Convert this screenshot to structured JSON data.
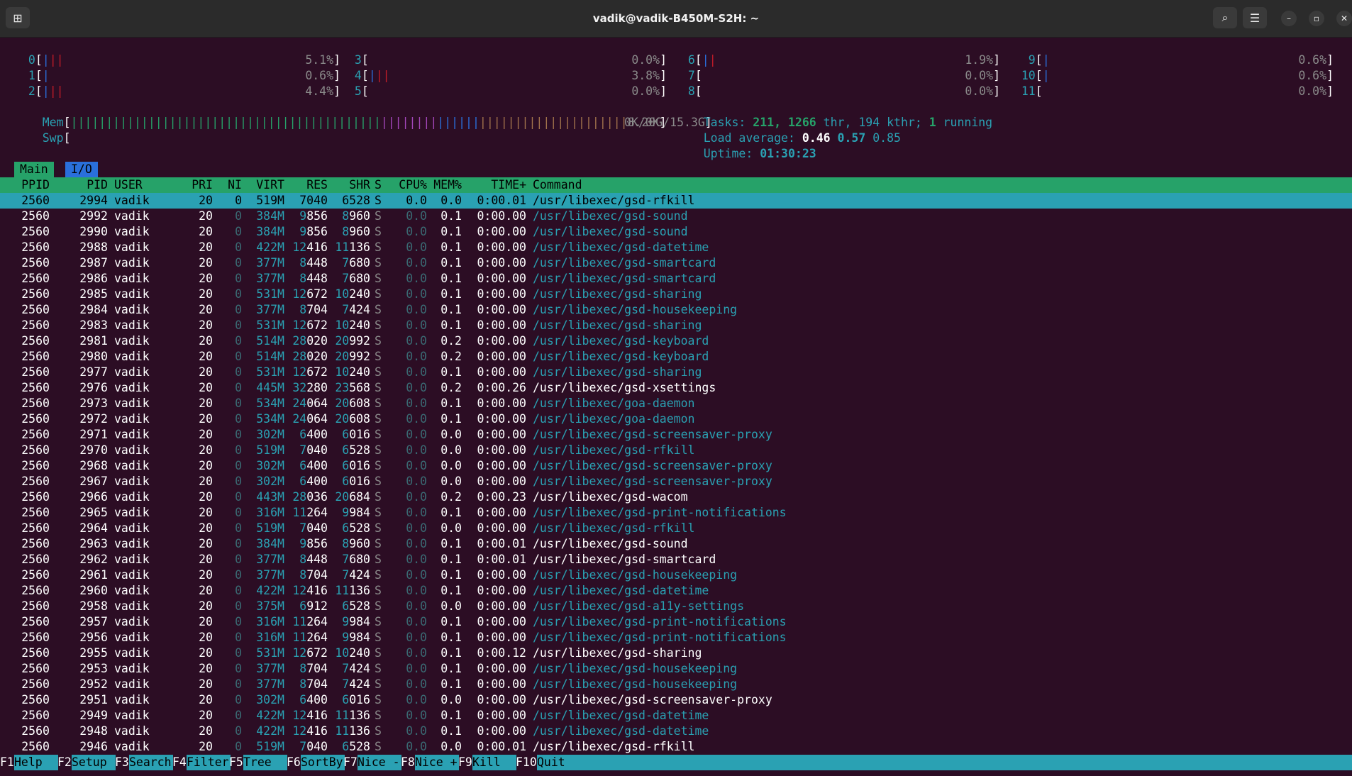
{
  "window": {
    "title": "vadik@vadik-B450M-S2H: ~"
  },
  "cpus": [
    {
      "id": "0",
      "pct": "5.1%"
    },
    {
      "id": "1",
      "pct": "0.6%"
    },
    {
      "id": "2",
      "pct": "4.4%"
    },
    {
      "id": "3",
      "pct": "0.0%"
    },
    {
      "id": "4",
      "pct": "3.8%"
    },
    {
      "id": "5",
      "pct": "0.0%"
    },
    {
      "id": "6",
      "pct": "1.9%"
    },
    {
      "id": "7",
      "pct": "0.0%"
    },
    {
      "id": "8",
      "pct": "0.0%"
    },
    {
      "id": "9",
      "pct": "0.6%"
    },
    {
      "id": "10",
      "pct": "0.6%"
    },
    {
      "id": "11",
      "pct": "0.0%"
    }
  ],
  "mem": {
    "label": "Mem",
    "value": "8.20G/15.3G",
    "fraction": 0.536
  },
  "swp": {
    "label": "Swp",
    "value": "0K/0K"
  },
  "tasks": {
    "label": "Tasks:",
    "count": "211,",
    "thr": "1266",
    "thr_label": "thr,",
    "kthr": "194 kthr;",
    "running": "1",
    "running_label": "running"
  },
  "load": {
    "label": "Load average:",
    "v1": "0.46",
    "v5": "0.57",
    "v15": "0.85"
  },
  "uptime": {
    "label": "Uptime:",
    "value": "01:30:23"
  },
  "tabs": {
    "main": "Main",
    "io": "I/O"
  },
  "columns": [
    "PPID",
    "PID",
    "USER",
    "PRI",
    "NI",
    "VIRT",
    "RES",
    "SHR",
    "S",
    "CPU%",
    "MEM%",
    "TIME+",
    "Command"
  ],
  "processes": [
    [
      "2560",
      "2994",
      "vadik",
      "20",
      "0",
      "519M",
      "7040",
      "6528",
      "S",
      "0.0",
      "0.0",
      "0:00.01",
      "/usr/libexec/gsd-rfkill"
    ],
    [
      "2560",
      "2992",
      "vadik",
      "20",
      "0",
      "384M",
      "9856",
      "8960",
      "S",
      "0.0",
      "0.1",
      "0:00.00",
      "/usr/libexec/gsd-sound"
    ],
    [
      "2560",
      "2990",
      "vadik",
      "20",
      "0",
      "384M",
      "9856",
      "8960",
      "S",
      "0.0",
      "0.1",
      "0:00.00",
      "/usr/libexec/gsd-sound"
    ],
    [
      "2560",
      "2988",
      "vadik",
      "20",
      "0",
      "422M",
      "12416",
      "11136",
      "S",
      "0.0",
      "0.1",
      "0:00.00",
      "/usr/libexec/gsd-datetime"
    ],
    [
      "2560",
      "2987",
      "vadik",
      "20",
      "0",
      "377M",
      "8448",
      "7680",
      "S",
      "0.0",
      "0.1",
      "0:00.00",
      "/usr/libexec/gsd-smartcard"
    ],
    [
      "2560",
      "2986",
      "vadik",
      "20",
      "0",
      "377M",
      "8448",
      "7680",
      "S",
      "0.0",
      "0.1",
      "0:00.00",
      "/usr/libexec/gsd-smartcard"
    ],
    [
      "2560",
      "2985",
      "vadik",
      "20",
      "0",
      "531M",
      "12672",
      "10240",
      "S",
      "0.0",
      "0.1",
      "0:00.00",
      "/usr/libexec/gsd-sharing"
    ],
    [
      "2560",
      "2984",
      "vadik",
      "20",
      "0",
      "377M",
      "8704",
      "7424",
      "S",
      "0.0",
      "0.1",
      "0:00.00",
      "/usr/libexec/gsd-housekeeping"
    ],
    [
      "2560",
      "2983",
      "vadik",
      "20",
      "0",
      "531M",
      "12672",
      "10240",
      "S",
      "0.0",
      "0.1",
      "0:00.00",
      "/usr/libexec/gsd-sharing"
    ],
    [
      "2560",
      "2981",
      "vadik",
      "20",
      "0",
      "514M",
      "28020",
      "20992",
      "S",
      "0.0",
      "0.2",
      "0:00.00",
      "/usr/libexec/gsd-keyboard"
    ],
    [
      "2560",
      "2980",
      "vadik",
      "20",
      "0",
      "514M",
      "28020",
      "20992",
      "S",
      "0.0",
      "0.2",
      "0:00.00",
      "/usr/libexec/gsd-keyboard"
    ],
    [
      "2560",
      "2977",
      "vadik",
      "20",
      "0",
      "531M",
      "12672",
      "10240",
      "S",
      "0.0",
      "0.1",
      "0:00.00",
      "/usr/libexec/gsd-sharing"
    ],
    [
      "2560",
      "2976",
      "vadik",
      "20",
      "0",
      "445M",
      "32280",
      "23568",
      "S",
      "0.0",
      "0.2",
      "0:00.26",
      "/usr/libexec/gsd-xsettings"
    ],
    [
      "2560",
      "2973",
      "vadik",
      "20",
      "0",
      "534M",
      "24064",
      "20608",
      "S",
      "0.0",
      "0.1",
      "0:00.00",
      "/usr/libexec/goa-daemon"
    ],
    [
      "2560",
      "2972",
      "vadik",
      "20",
      "0",
      "534M",
      "24064",
      "20608",
      "S",
      "0.0",
      "0.1",
      "0:00.00",
      "/usr/libexec/goa-daemon"
    ],
    [
      "2560",
      "2971",
      "vadik",
      "20",
      "0",
      "302M",
      "6400",
      "6016",
      "S",
      "0.0",
      "0.0",
      "0:00.00",
      "/usr/libexec/gsd-screensaver-proxy"
    ],
    [
      "2560",
      "2970",
      "vadik",
      "20",
      "0",
      "519M",
      "7040",
      "6528",
      "S",
      "0.0",
      "0.0",
      "0:00.00",
      "/usr/libexec/gsd-rfkill"
    ],
    [
      "2560",
      "2968",
      "vadik",
      "20",
      "0",
      "302M",
      "6400",
      "6016",
      "S",
      "0.0",
      "0.0",
      "0:00.00",
      "/usr/libexec/gsd-screensaver-proxy"
    ],
    [
      "2560",
      "2967",
      "vadik",
      "20",
      "0",
      "302M",
      "6400",
      "6016",
      "S",
      "0.0",
      "0.0",
      "0:00.00",
      "/usr/libexec/gsd-screensaver-proxy"
    ],
    [
      "2560",
      "2966",
      "vadik",
      "20",
      "0",
      "443M",
      "28036",
      "20684",
      "S",
      "0.0",
      "0.2",
      "0:00.23",
      "/usr/libexec/gsd-wacom"
    ],
    [
      "2560",
      "2965",
      "vadik",
      "20",
      "0",
      "316M",
      "11264",
      "9984",
      "S",
      "0.0",
      "0.1",
      "0:00.00",
      "/usr/libexec/gsd-print-notifications"
    ],
    [
      "2560",
      "2964",
      "vadik",
      "20",
      "0",
      "519M",
      "7040",
      "6528",
      "S",
      "0.0",
      "0.0",
      "0:00.00",
      "/usr/libexec/gsd-rfkill"
    ],
    [
      "2560",
      "2963",
      "vadik",
      "20",
      "0",
      "384M",
      "9856",
      "8960",
      "S",
      "0.0",
      "0.1",
      "0:00.01",
      "/usr/libexec/gsd-sound"
    ],
    [
      "2560",
      "2962",
      "vadik",
      "20",
      "0",
      "377M",
      "8448",
      "7680",
      "S",
      "0.0",
      "0.1",
      "0:00.01",
      "/usr/libexec/gsd-smartcard"
    ],
    [
      "2560",
      "2961",
      "vadik",
      "20",
      "0",
      "377M",
      "8704",
      "7424",
      "S",
      "0.0",
      "0.1",
      "0:00.00",
      "/usr/libexec/gsd-housekeeping"
    ],
    [
      "2560",
      "2960",
      "vadik",
      "20",
      "0",
      "422M",
      "12416",
      "11136",
      "S",
      "0.0",
      "0.1",
      "0:00.00",
      "/usr/libexec/gsd-datetime"
    ],
    [
      "2560",
      "2958",
      "vadik",
      "20",
      "0",
      "375M",
      "6912",
      "6528",
      "S",
      "0.0",
      "0.0",
      "0:00.00",
      "/usr/libexec/gsd-a11y-settings"
    ],
    [
      "2560",
      "2957",
      "vadik",
      "20",
      "0",
      "316M",
      "11264",
      "9984",
      "S",
      "0.0",
      "0.1",
      "0:00.00",
      "/usr/libexec/gsd-print-notifications"
    ],
    [
      "2560",
      "2956",
      "vadik",
      "20",
      "0",
      "316M",
      "11264",
      "9984",
      "S",
      "0.0",
      "0.1",
      "0:00.00",
      "/usr/libexec/gsd-print-notifications"
    ],
    [
      "2560",
      "2955",
      "vadik",
      "20",
      "0",
      "531M",
      "12672",
      "10240",
      "S",
      "0.0",
      "0.1",
      "0:00.12",
      "/usr/libexec/gsd-sharing"
    ],
    [
      "2560",
      "2953",
      "vadik",
      "20",
      "0",
      "377M",
      "8704",
      "7424",
      "S",
      "0.0",
      "0.1",
      "0:00.00",
      "/usr/libexec/gsd-housekeeping"
    ],
    [
      "2560",
      "2952",
      "vadik",
      "20",
      "0",
      "377M",
      "8704",
      "7424",
      "S",
      "0.0",
      "0.1",
      "0:00.00",
      "/usr/libexec/gsd-housekeeping"
    ],
    [
      "2560",
      "2951",
      "vadik",
      "20",
      "0",
      "302M",
      "6400",
      "6016",
      "S",
      "0.0",
      "0.0",
      "0:00.00",
      "/usr/libexec/gsd-screensaver-proxy"
    ],
    [
      "2560",
      "2949",
      "vadik",
      "20",
      "0",
      "422M",
      "12416",
      "11136",
      "S",
      "0.0",
      "0.1",
      "0:00.00",
      "/usr/libexec/gsd-datetime"
    ],
    [
      "2560",
      "2948",
      "vadik",
      "20",
      "0",
      "422M",
      "12416",
      "11136",
      "S",
      "0.0",
      "0.1",
      "0:00.00",
      "/usr/libexec/gsd-datetime"
    ],
    [
      "2560",
      "2946",
      "vadik",
      "20",
      "0",
      "519M",
      "7040",
      "6528",
      "S",
      "0.0",
      "0.0",
      "0:00.01",
      "/usr/libexec/gsd-rfkill"
    ]
  ],
  "bright_commands": [
    "2994",
    "2976",
    "2966",
    "2963",
    "2962",
    "2955",
    "2951",
    "2946"
  ],
  "function_keys": [
    {
      "key": "F1",
      "label": "Help"
    },
    {
      "key": "F2",
      "label": "Setup"
    },
    {
      "key": "F3",
      "label": "Search"
    },
    {
      "key": "F4",
      "label": "Filter"
    },
    {
      "key": "F5",
      "label": "Tree"
    },
    {
      "key": "F6",
      "label": "SortBy"
    },
    {
      "key": "F7",
      "label": "Nice -"
    },
    {
      "key": "F8",
      "label": "Nice +"
    },
    {
      "key": "F9",
      "label": "Kill"
    },
    {
      "key": "F10",
      "label": "Quit"
    }
  ],
  "colors": {
    "accent": "#2aa1b3",
    "header": "#26a269",
    "background": "#2c0d24"
  }
}
